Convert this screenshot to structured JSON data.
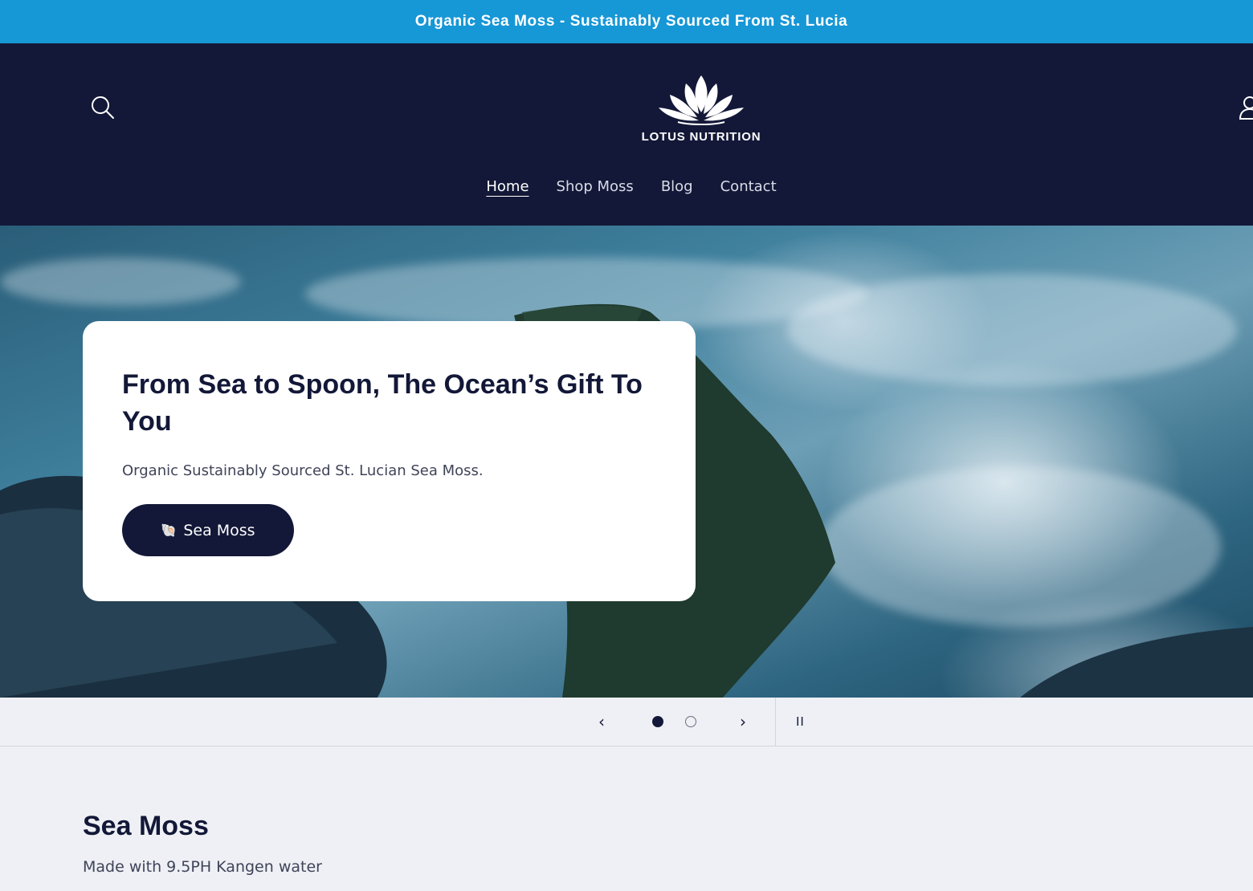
{
  "announcement": {
    "text": "Organic Sea Moss - Sustainably Sourced From St. Lucia"
  },
  "header": {
    "brand": "LOTUS NUTRITION",
    "icons": {
      "search": "search-icon",
      "account": "account-icon",
      "logo": "lotus-logo-icon"
    }
  },
  "nav": {
    "items": [
      {
        "label": "Home",
        "active": true
      },
      {
        "label": "Shop Moss",
        "active": false
      },
      {
        "label": "Blog",
        "active": false
      },
      {
        "label": "Contact",
        "active": false
      }
    ]
  },
  "hero": {
    "title": "From Sea to Spoon, The Ocean’s Gift To You",
    "subtitle": "Organic Sustainably Sourced St. Lucian Sea Moss.",
    "button_emoji": "🐚",
    "button_label": "Sea Moss"
  },
  "slider": {
    "prev": "‹",
    "next": "›",
    "pause": "II",
    "slide_count": 2,
    "current_slide": 1
  },
  "section": {
    "title": "Sea Moss",
    "subtitle": "Made with 9.5PH Kangen water"
  },
  "colors": {
    "announcement_bg": "#1697d6",
    "header_bg": "#131838",
    "page_bg": "#eef0f5",
    "button_bg": "#131838"
  }
}
